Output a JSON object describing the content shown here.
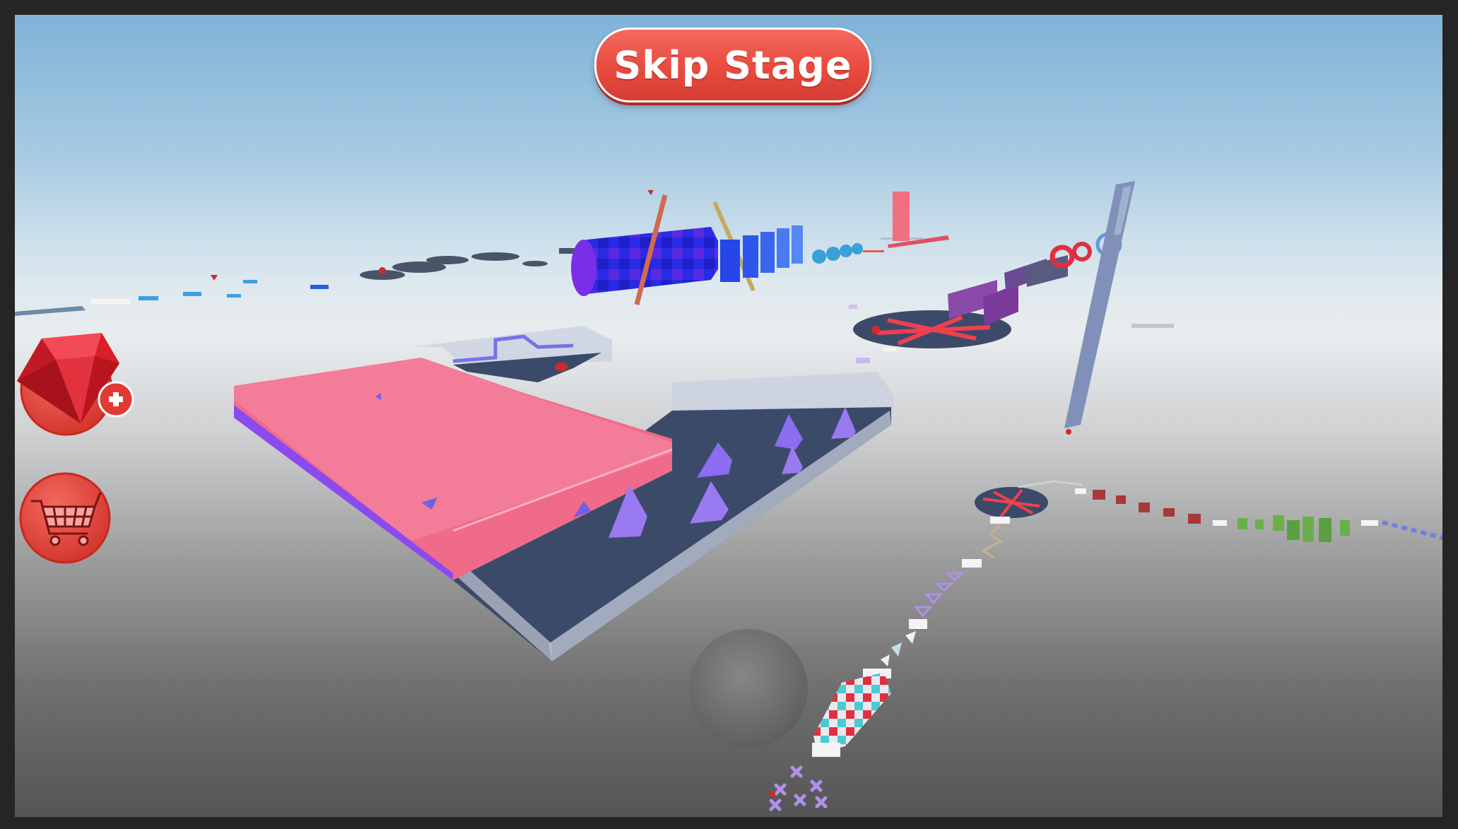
{
  "hud": {
    "skip_button_label": "Skip Stage",
    "gem_shop_button": {
      "icon": "ruby-gem-icon",
      "badge_icon": "plus-icon"
    },
    "store_button": {
      "icon": "shopping-cart-icon"
    }
  },
  "colors": {
    "button_red": "#e94a3f",
    "sky_top": "#7fb3d8",
    "horizon": "#e9ecee",
    "ground_dark": "#555555",
    "obstacle_pink": "#f06a8a",
    "obstacle_purple": "#8c6cf0",
    "obstacle_blue": "#3030e0",
    "platform_navy": "#3c4a6a"
  }
}
